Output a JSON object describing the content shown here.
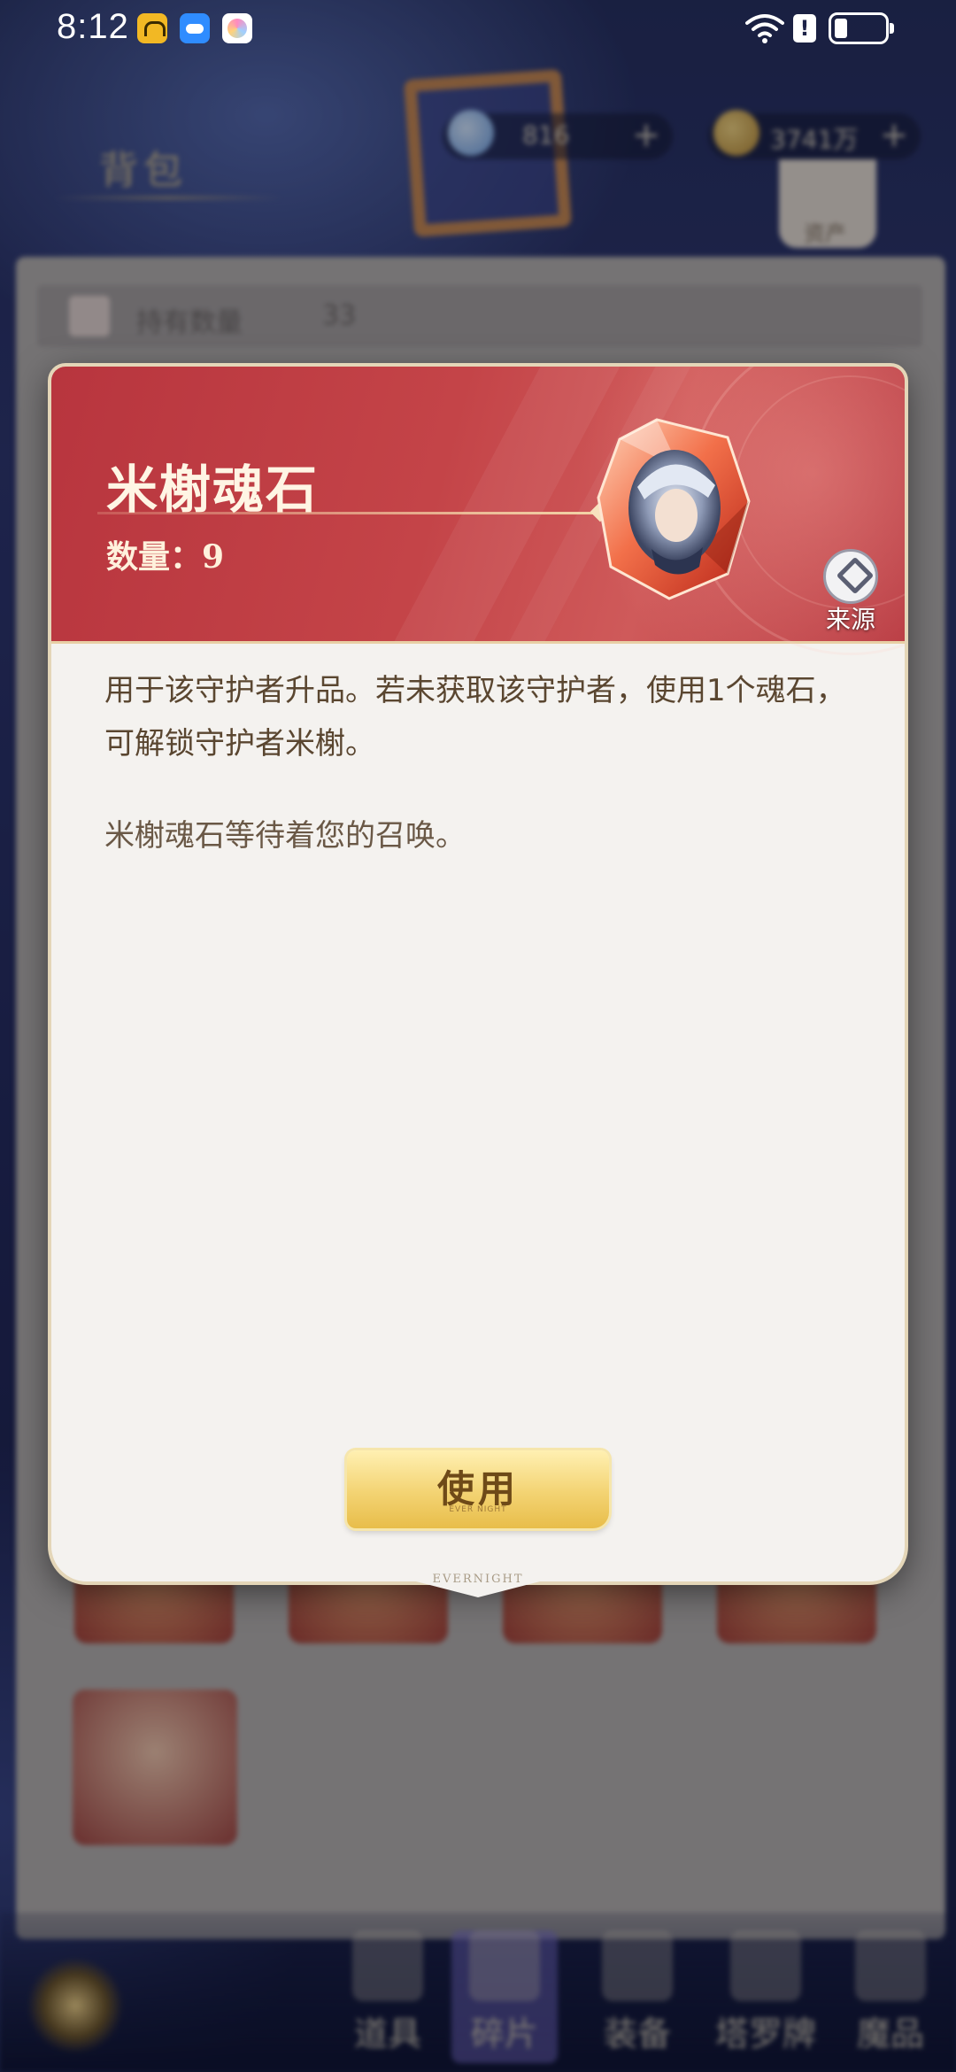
{
  "status_bar": {
    "time": "8:12",
    "alert_glyph": "!",
    "icons": [
      "app-icon-yellow",
      "app-icon-weather",
      "app-icon-color",
      "wifi-icon",
      "alert-icon",
      "battery-icon"
    ]
  },
  "background": {
    "title": "背包",
    "currency_gem": "816",
    "currency_gold": "3741万",
    "plus_label": "+",
    "assets_label": "资产",
    "count_label": "持有数量",
    "count_value": "33",
    "nav": [
      {
        "label": "道具"
      },
      {
        "label": "碎片"
      },
      {
        "label": "装备"
      },
      {
        "label": "塔罗牌"
      },
      {
        "label": "魔品"
      }
    ]
  },
  "modal": {
    "item_name": "米榭魂石",
    "quantity_text": "数量：9",
    "source_label": "来源",
    "description": "用于该守护者升品。若未获取该守护者，使用1个魂石，可解锁守护者米榭。",
    "flavor_text": "米榭魂石等待着您的召唤。",
    "use_button_label": "使用",
    "use_button_sub": "EVER NIGHT",
    "footer_brand": "EVERNIGHT"
  },
  "colors": {
    "header_red": "#c44448",
    "panel_bg": "#f4f2ef",
    "button_gold": "#f3d372",
    "text_brown": "#5a4630"
  }
}
